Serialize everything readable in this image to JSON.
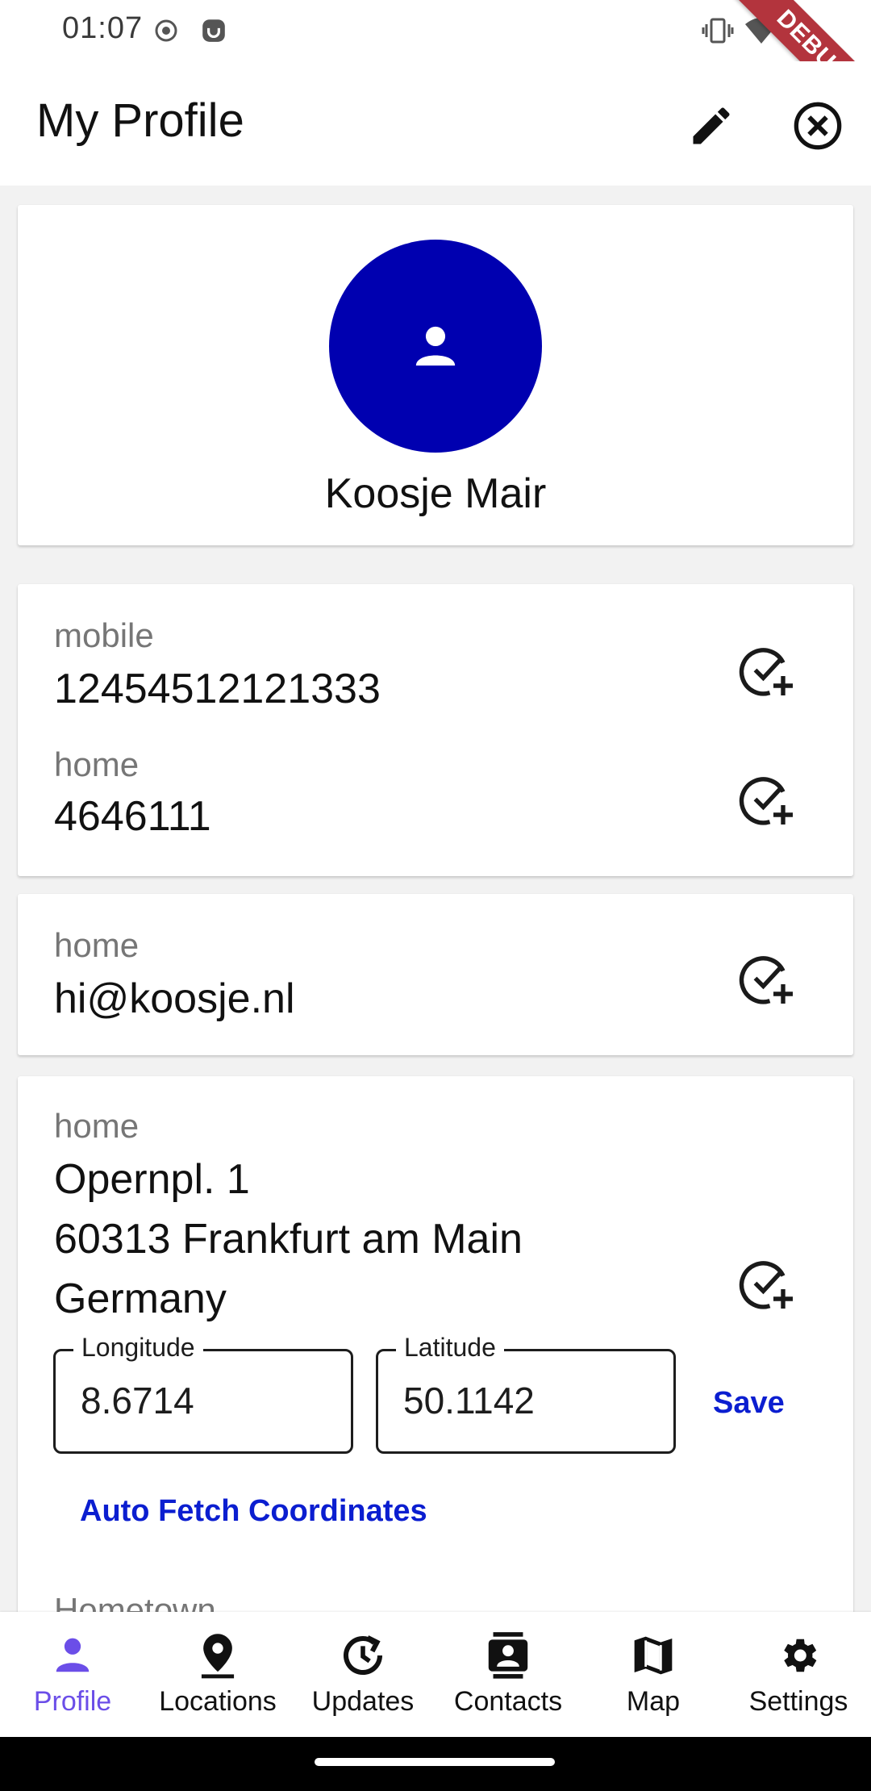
{
  "status_bar": {
    "time": "01:07",
    "debug_label": "DEBUG"
  },
  "app_bar": {
    "title": "My Profile",
    "edit_icon": "pencil-icon",
    "close_icon": "close-circle-icon"
  },
  "profile": {
    "name": "Koosje Mair",
    "avatar_icon": "person-icon",
    "avatar_color": "#0000b0"
  },
  "phones": [
    {
      "label": "mobile",
      "value": "12454512121333"
    },
    {
      "label": "home",
      "value": "4646111"
    }
  ],
  "emails": [
    {
      "label": "home",
      "value": "hi@koosje.nl"
    }
  ],
  "address": {
    "label": "home",
    "line1": "Opernpl. 1",
    "line2": "60313 Frankfurt am Main",
    "line3": "Germany",
    "longitude_label": "Longitude",
    "longitude_value": "8.6714",
    "latitude_label": "Latitude",
    "latitude_value": "50.1142",
    "save_label": "Save",
    "auto_fetch_label": "Auto Fetch Coordinates"
  },
  "next_section_label": "Hometown",
  "accent_color": "#0b1ed0",
  "nav": {
    "active_color": "#6b4ee8",
    "items": [
      {
        "label": "Profile",
        "icon": "person-icon"
      },
      {
        "label": "Locations",
        "icon": "location-pin-icon"
      },
      {
        "label": "Updates",
        "icon": "history-icon"
      },
      {
        "label": "Contacts",
        "icon": "contacts-icon"
      },
      {
        "label": "Map",
        "icon": "map-icon"
      },
      {
        "label": "Settings",
        "icon": "gear-icon"
      }
    ]
  }
}
